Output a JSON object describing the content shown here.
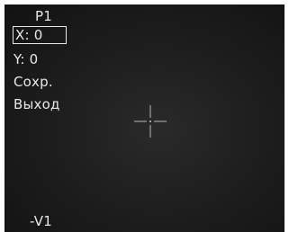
{
  "osd": {
    "profile_label": "P1",
    "menu": {
      "x_value": "X: 0",
      "y_value": "Y: 0",
      "save": "Сохр.",
      "exit": "Выход"
    },
    "version_label": "-V1"
  },
  "colors": {
    "background": "#1e1e1e",
    "text": "#e8e8e8",
    "crosshair": "#b8b8b8"
  },
  "icons": {
    "reticle": "crosshair-icon"
  }
}
